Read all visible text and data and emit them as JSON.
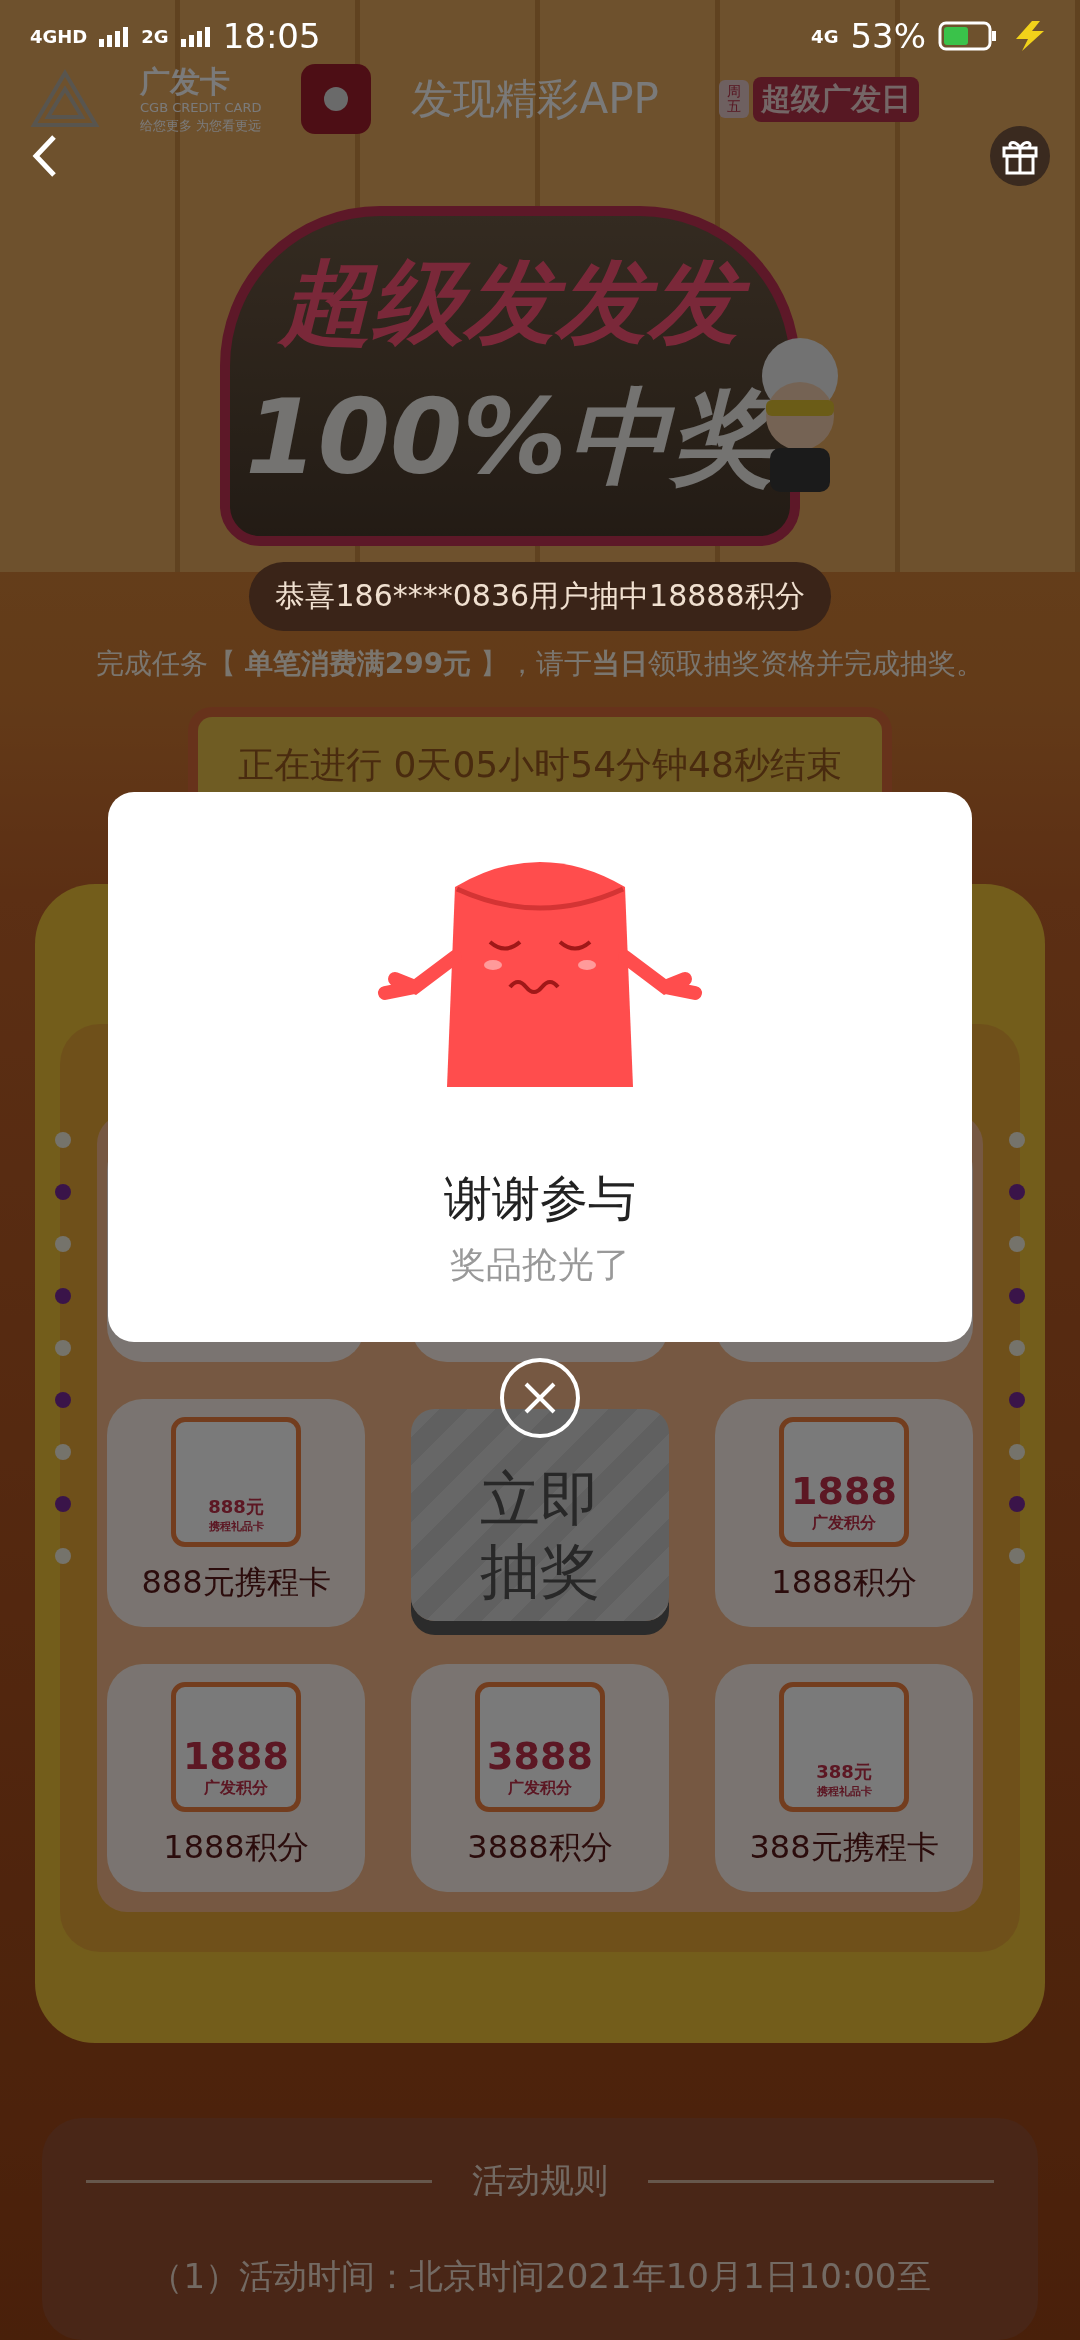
{
  "status_bar": {
    "network_primary": "4GHD",
    "network_secondary": "2G",
    "time": "18:05",
    "network_data": "4G",
    "battery": "53%"
  },
  "header_banner": {
    "brand": "广发卡",
    "brand_sub": "CGB CREDIT CARD",
    "slogan": "给您更多  为您看更远",
    "app_slogan": "发现精彩APP",
    "day_badge": "周五",
    "event_badge": "超级广发日"
  },
  "hero": {
    "title": "超级发发发",
    "subtitle": "100%中奖"
  },
  "ticker": "恭喜186****0836用户抽中18888积分",
  "task": "完成任务【 **单笔消费满299元** 】，请于**当日**领取抽奖资格并完成抽奖。",
  "countdown": "正在进行 0天05小时54分钟48秒结束",
  "prize_grid": [
    {
      "kind": "prize",
      "label": "888元携程卡",
      "art": {
        "kind": "card",
        "amount": "888元",
        "name": "携程礼品卡"
      }
    },
    {
      "kind": "start",
      "label": "立即抽奖"
    },
    {
      "kind": "prize",
      "label": "1888积分",
      "art": {
        "kind": "points",
        "amount": "1888",
        "name": "广发积分"
      }
    },
    {
      "kind": "prize",
      "label": "1888积分",
      "art": {
        "kind": "points",
        "amount": "1888",
        "name": "广发积分"
      }
    },
    {
      "kind": "prize",
      "label": "3888积分",
      "art": {
        "kind": "points",
        "amount": "3888",
        "name": "广发积分"
      }
    },
    {
      "kind": "prize",
      "label": "388元携程卡",
      "art": {
        "kind": "card",
        "amount": "388元",
        "name": "携程礼品卡"
      }
    }
  ],
  "modal": {
    "title": "谢谢参与",
    "message": "奖品抢光了"
  },
  "rules": {
    "title": "活动规则",
    "lines": [
      "（1）活动时间：北京时间2021年10月1日10:00至"
    ]
  }
}
